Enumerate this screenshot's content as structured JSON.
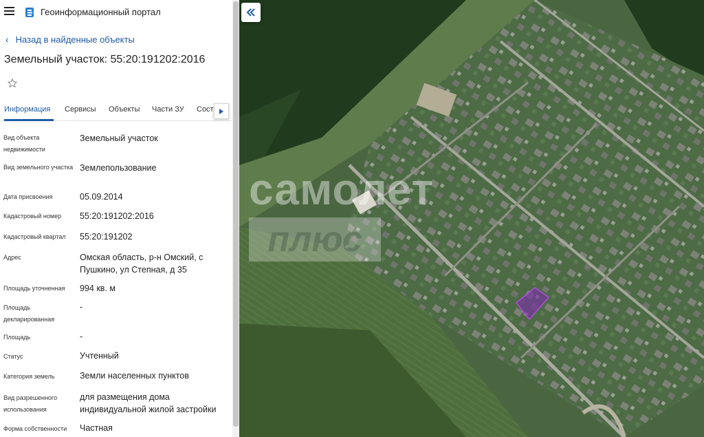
{
  "app": {
    "title": "Геоинформационный портал"
  },
  "nav": {
    "back_label": "Назад в найденные объекты"
  },
  "object": {
    "title": "Земельный участок: 55:20:191202:2016"
  },
  "tabs": [
    {
      "label": "Информация",
      "active": true
    },
    {
      "label": "Сервисы",
      "active": false
    },
    {
      "label": "Объекты",
      "active": false
    },
    {
      "label": "Части ЗУ",
      "active": false
    },
    {
      "label": "Состав",
      "active": false
    }
  ],
  "attributes": [
    {
      "label": "Вид объекта недвижимости",
      "value": "Земельный участок"
    },
    {
      "label": "Вид земельного участка",
      "value": "Землепользование"
    },
    {
      "label": "Дата присвоения",
      "value": "05.09.2014"
    },
    {
      "label": "Кадастровый номер",
      "value": "55:20:191202:2016"
    },
    {
      "label": "Кадастровый квартал",
      "value": "55:20:191202"
    },
    {
      "label": "Адрес",
      "value": "Омская область, р-н Омский, с Пушкино, ул Степная, д 35"
    },
    {
      "label": "Площадь уточненная",
      "value": "994 кв. м"
    },
    {
      "label": "Площадь декларированная",
      "value": "-"
    },
    {
      "label": "Площадь",
      "value": "-"
    },
    {
      "label": "Статус",
      "value": "Учтенный"
    },
    {
      "label": "Категория земель",
      "value": "Земли населенных пунктов"
    },
    {
      "label": "Вид разрешенного использования",
      "value": "для размещения дома индивидуальной жилой застройки"
    },
    {
      "label": "Форма собственности",
      "value": "Частная"
    }
  ],
  "map": {
    "watermark_line1": "самолет",
    "watermark_line2": "плюс",
    "parcel_color": "#7a2fa8"
  },
  "colors": {
    "accent": "#1f5aa6",
    "text": "#222222"
  },
  "icons": {
    "menu": "hamburger-icon",
    "logo": "portal-logo-icon",
    "back": "chevron-left-icon",
    "favorite": "star-outline-icon",
    "tab_scroll": "triangle-right-icon",
    "collapse": "double-chevron-left-icon"
  }
}
